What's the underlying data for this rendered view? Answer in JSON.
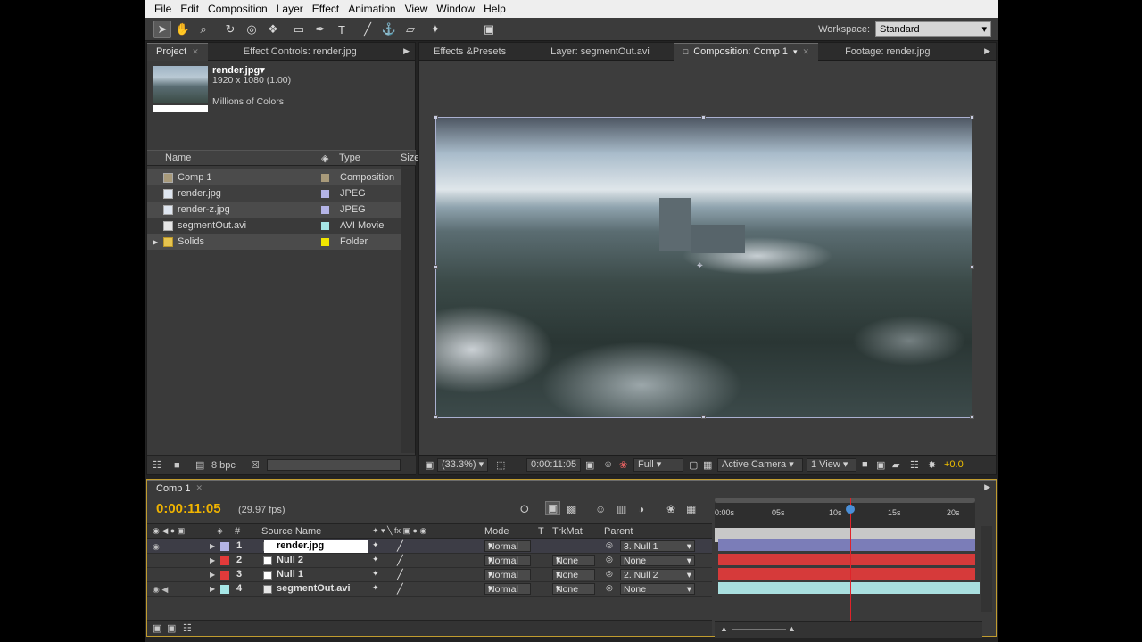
{
  "menu": [
    "File",
    "Edit",
    "Composition",
    "Layer",
    "Effect",
    "Animation",
    "View",
    "Window",
    "Help"
  ],
  "toolbar": {
    "workspace_label": "Workspace:",
    "workspace_value": "Standard"
  },
  "project_panel": {
    "tabs": [
      "Project",
      "Effect Controls: render.jpg"
    ],
    "file_name": "render.jpg▾",
    "file_size": "1920 x 1080 (1.00)",
    "file_colors": "Millions of Colors",
    "columns": [
      "Name",
      "Type",
      "Size"
    ],
    "items": [
      {
        "name": "Comp 1",
        "type": "Composition",
        "label_color": "#a89a7a"
      },
      {
        "name": "render.jpg",
        "type": "JPEG",
        "label_color": "#b4b4e6"
      },
      {
        "name": "render-z.jpg",
        "type": "JPEG",
        "label_color": "#b4b4e6"
      },
      {
        "name": "segmentOut.avi",
        "type": "AVI Movie",
        "label_color": "#a6e6e6"
      },
      {
        "name": "Solids",
        "type": "Folder",
        "label_color": "#f2e600"
      }
    ],
    "bpc": "8 bpc"
  },
  "comp_panel": {
    "tabs": [
      "Effects &Presets",
      "Layer: segmentOut.avi",
      "Composition: Comp 1",
      "Footage: render.jpg"
    ],
    "zoom": "(33.3%)",
    "timecode": "0:00:11:05",
    "resolution": "Full",
    "camera": "Active Camera",
    "views": "1 View",
    "exposure": "+0.0"
  },
  "timeline": {
    "tab": "Comp 1",
    "timecode": "0:00:11:05",
    "fps": "(29.97 fps)",
    "columns": {
      "num": "#",
      "source": "Source Name",
      "mode": "Mode",
      "t": "T",
      "trkmat": "TrkMat",
      "parent": "Parent"
    },
    "ruler": [
      "0:00s",
      "05s",
      "10s",
      "15s",
      "20s"
    ],
    "layers": [
      {
        "num": "1",
        "name": "render.jpg",
        "mode": "Normal",
        "trkmat": "",
        "parent": "3. Null 1",
        "label_color": "#b4b4e6",
        "bar_color": "#7b7db8"
      },
      {
        "num": "2",
        "name": "Null 2",
        "mode": "Normal",
        "trkmat": "None",
        "parent": "None",
        "label_color": "#e23a3a",
        "bar_color": "#d63a3a"
      },
      {
        "num": "3",
        "name": "Null 1",
        "mode": "Normal",
        "trkmat": "None",
        "parent": "2. Null 2",
        "label_color": "#e23a3a",
        "bar_color": "#d63a3a"
      },
      {
        "num": "4",
        "name": "segmentOut.avi",
        "mode": "Normal",
        "trkmat": "None",
        "parent": "None",
        "label_color": "#a6e6e6",
        "bar_color": "#a9dfdf"
      }
    ]
  }
}
